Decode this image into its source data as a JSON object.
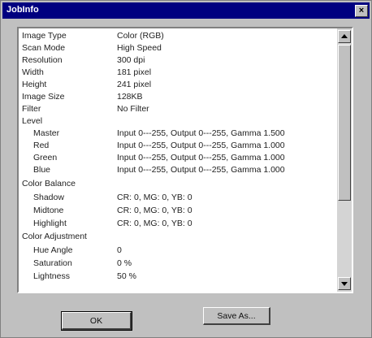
{
  "window": {
    "title": "JobInfo",
    "close_label": "×"
  },
  "rows": [
    {
      "label": "Image Type",
      "value": "Color (RGB)"
    },
    {
      "label": "Scan Mode",
      "value": "High Speed"
    },
    {
      "label": "Resolution",
      "value": "300 dpi"
    },
    {
      "label": "Width",
      "value": "181 pixel"
    },
    {
      "label": "Height",
      "value": "241 pixel"
    },
    {
      "label": "Image Size",
      "value": "128KB"
    },
    {
      "label": "Filter",
      "value": "No Filter"
    },
    {
      "label": "Level",
      "value": ""
    },
    {
      "label": "Master",
      "value": "Input 0---255, Output 0---255, Gamma 1.500"
    },
    {
      "label": "Red",
      "value": "Input 0---255, Output 0---255, Gamma 1.000"
    },
    {
      "label": "Green",
      "value": "Input 0---255, Output 0---255, Gamma 1.000"
    },
    {
      "label": "Blue",
      "value": "Input 0---255, Output 0---255, Gamma 1.000"
    },
    {
      "label": "Color Balance",
      "value": ""
    },
    {
      "label": "Shadow",
      "value": "CR: 0, MG: 0, YB: 0"
    },
    {
      "label": "Midtone",
      "value": "CR: 0, MG: 0, YB: 0"
    },
    {
      "label": "Highlight",
      "value": "CR: 0, MG: 0, YB: 0"
    },
    {
      "label": "Color Adjustment",
      "value": ""
    },
    {
      "label": "Hue Angle",
      "value": "0"
    },
    {
      "label": "Saturation",
      "value": "0 %"
    },
    {
      "label": "Lightness",
      "value": "50 %"
    }
  ],
  "buttons": {
    "ok": "OK",
    "save_as": "Save As..."
  }
}
